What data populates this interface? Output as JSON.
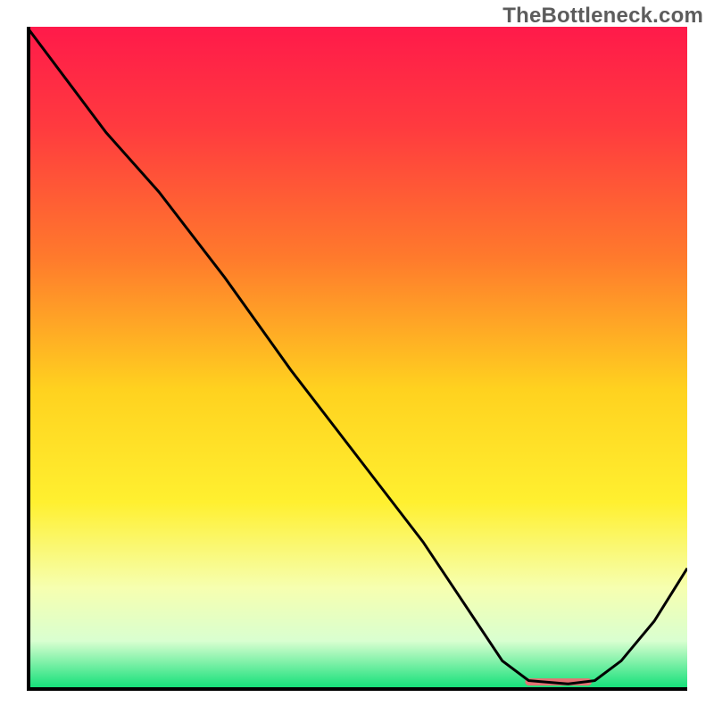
{
  "watermark": "TheBottleneck.com",
  "chart_data": {
    "type": "line",
    "title": "",
    "xlabel": "",
    "ylabel": "",
    "xlim": [
      0,
      100
    ],
    "ylim": [
      0,
      100
    ],
    "grid": false,
    "legend": false,
    "gradient_stops": [
      {
        "offset": 0.0,
        "color": "#ff1a4a"
      },
      {
        "offset": 0.15,
        "color": "#ff3a3f"
      },
      {
        "offset": 0.35,
        "color": "#ff7a2c"
      },
      {
        "offset": 0.55,
        "color": "#ffd21f"
      },
      {
        "offset": 0.72,
        "color": "#fff030"
      },
      {
        "offset": 0.85,
        "color": "#f6ffb0"
      },
      {
        "offset": 0.93,
        "color": "#d9ffd0"
      },
      {
        "offset": 1.0,
        "color": "#16e07a"
      }
    ],
    "series": [
      {
        "name": "curve",
        "x": [
          0,
          6,
          12,
          20,
          30,
          40,
          50,
          60,
          68,
          72,
          76,
          82,
          86,
          90,
          95,
          100
        ],
        "y": [
          100,
          92,
          84,
          75,
          62,
          48,
          35,
          22,
          10,
          4,
          1,
          0.5,
          1,
          4,
          10,
          18
        ]
      }
    ],
    "marker": {
      "name": "optimal-range-marker",
      "x_start": 76,
      "x_end": 85,
      "y": 0.8,
      "color": "#e57373",
      "thickness": 8
    }
  }
}
